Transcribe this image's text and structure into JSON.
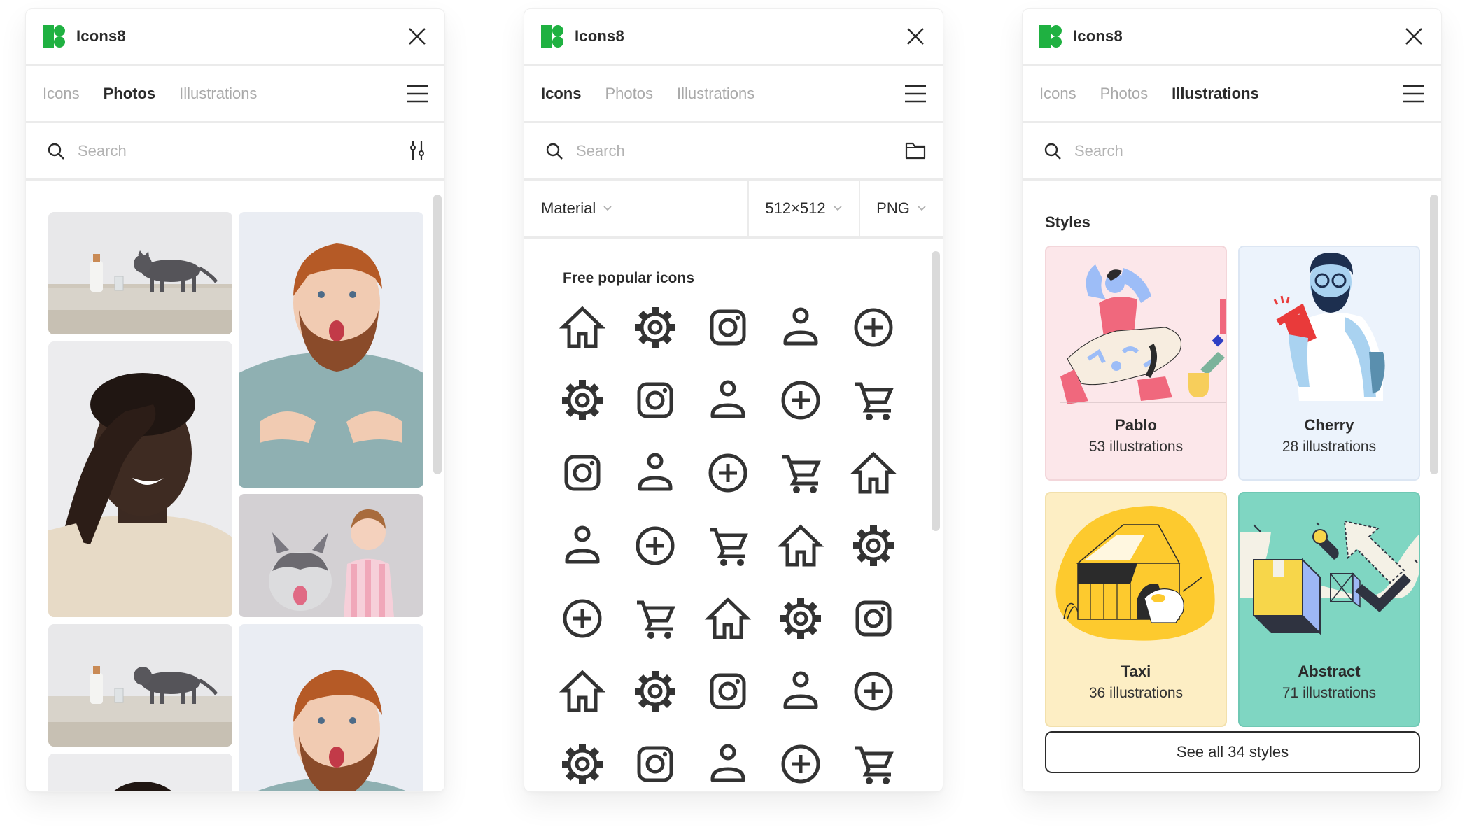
{
  "brand": {
    "name": "Icons8",
    "color": "#1fb141"
  },
  "panels": {
    "photos": {
      "title": "Icons8",
      "tabs": [
        {
          "label": "Icons",
          "active": false
        },
        {
          "label": "Photos",
          "active": true
        },
        {
          "label": "Illustrations",
          "active": false
        }
      ],
      "search": {
        "placeholder": "Search",
        "value": "",
        "right_icon": "filter-sliders-icon"
      },
      "photos": [
        {
          "subject": "gray cat on table with milk bottle"
        },
        {
          "subject": "surprised red-haired bearded man"
        },
        {
          "subject": "laughing man covering eye with hand"
        },
        {
          "subject": "husky dog with smiling girl"
        },
        {
          "subject": "gray cat on table with milk bottle"
        },
        {
          "subject": "surprised red-haired bearded man"
        },
        {
          "subject": "laughing man covering eye with hand"
        }
      ]
    },
    "icons": {
      "title": "Icons8",
      "tabs": [
        {
          "label": "Icons",
          "active": true
        },
        {
          "label": "Photos",
          "active": false
        },
        {
          "label": "Illustrations",
          "active": false
        }
      ],
      "search": {
        "placeholder": "Search",
        "value": "",
        "right_icon": "folder-icon"
      },
      "filters": {
        "style": "Material",
        "size": "512×512",
        "format": "PNG"
      },
      "section_title": "Free popular icons",
      "grid": [
        [
          "home",
          "settings",
          "instagram",
          "user",
          "add"
        ],
        [
          "settings",
          "instagram",
          "user",
          "add",
          "cart"
        ],
        [
          "instagram",
          "user",
          "add",
          "cart",
          "home"
        ],
        [
          "user",
          "add",
          "cart",
          "home",
          "settings"
        ],
        [
          "add",
          "cart",
          "home",
          "settings",
          "instagram"
        ],
        [
          "home",
          "settings",
          "instagram",
          "user",
          "add"
        ],
        [
          "settings",
          "instagram",
          "user",
          "add",
          "cart"
        ]
      ]
    },
    "illustrations": {
      "title": "Icons8",
      "tabs": [
        {
          "label": "Icons",
          "active": false
        },
        {
          "label": "Photos",
          "active": false
        },
        {
          "label": "Illustrations",
          "active": true
        }
      ],
      "search": {
        "placeholder": "Search",
        "value": ""
      },
      "section_title": "Styles",
      "styles": [
        {
          "name": "Pablo",
          "count": "53 illustrations",
          "bg": "#fce7ea",
          "border": "#f3d6da"
        },
        {
          "name": "Cherry",
          "count": "28 illustrations",
          "bg": "#ecf3fc",
          "border": "#dce6f3"
        },
        {
          "name": "Taxi",
          "count": "36 illustrations",
          "bg": "#fdeec4",
          "border": "#f2e0ac"
        },
        {
          "name": "Abstract",
          "count": "71 illustrations",
          "bg": "#7fd6c2",
          "border": "#6fc8b4"
        }
      ],
      "see_all_label": "See all 34 styles"
    }
  }
}
